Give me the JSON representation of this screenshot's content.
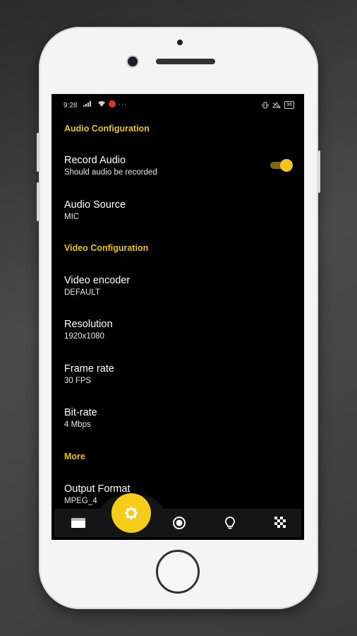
{
  "status_bar": {
    "time": "9:28",
    "battery": "96"
  },
  "sections": {
    "audio": "Audio Configuration",
    "video": "Video Configuration",
    "more": "More"
  },
  "preferences": {
    "record_audio": {
      "title": "Record Audio",
      "summary": "Should audio be recorded",
      "enabled": true
    },
    "audio_source": {
      "title": "Audio Source",
      "summary": "MIC"
    },
    "video_encoder": {
      "title": "Video encoder",
      "summary": "DEFAULT"
    },
    "resolution": {
      "title": "Resolution",
      "summary": "1920x1080"
    },
    "frame_rate": {
      "title": "Frame rate",
      "summary": "30 FPS"
    },
    "bit_rate": {
      "title": "Bit-rate",
      "summary": "4 Mbps"
    },
    "output_format": {
      "title": "Output Format",
      "summary": "MPEG_4"
    }
  },
  "bottom_nav": {
    "items": [
      "videos-icon",
      "settings-icon",
      "record-icon",
      "lightbulb-icon",
      "checkered-icon"
    ],
    "active": "settings-icon"
  },
  "colors": {
    "accent": "#f5cc18",
    "section_header": "#e8c21a",
    "screen_bg": "#000000",
    "nav_bg": "#151515"
  }
}
